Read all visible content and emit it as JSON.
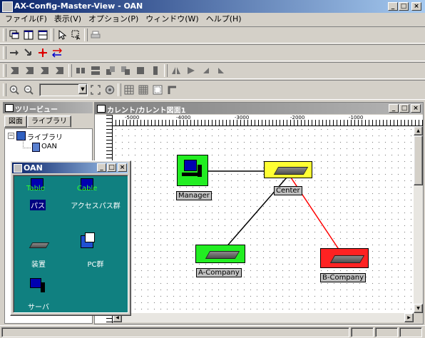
{
  "window": {
    "title": "AX-Config-Master-View - OAN"
  },
  "menu": [
    "ファイル(F)",
    "表示(V)",
    "オプション(P)",
    "ウィンドウ(W)",
    "ヘルプ(H)"
  ],
  "tree_panel": {
    "title": "ツリービュー",
    "tabs": [
      "図面",
      "ライブラリ"
    ],
    "root": "ライブラリ",
    "child": "OAN"
  },
  "palette": {
    "title": "OAN",
    "items": [
      {
        "label": "パス",
        "sub": "Table"
      },
      {
        "label": "アクセスパス群",
        "sub": "Cable"
      },
      {
        "label": "装置"
      },
      {
        "label": "PC群"
      },
      {
        "label": "サーバ"
      }
    ]
  },
  "diagram": {
    "title": "カレント/カレント図面1",
    "ruler_labels": [
      "-5000",
      "-4000",
      "-3000",
      "-2000",
      "-1000"
    ],
    "nodes": [
      {
        "id": "manager",
        "label": "Manager",
        "color": "#22ee22"
      },
      {
        "id": "center",
        "label": "Center",
        "color": "#ffff33"
      },
      {
        "id": "a",
        "label": "A-Company",
        "color": "#22ee22"
      },
      {
        "id": "b",
        "label": "B-Company",
        "color": "#ff2222"
      }
    ],
    "links": [
      {
        "from": "manager",
        "to": "center",
        "color": "#000000"
      },
      {
        "from": "center",
        "to": "a",
        "color": "#000000"
      },
      {
        "from": "center",
        "to": "b",
        "color": "#ff0000"
      }
    ]
  }
}
